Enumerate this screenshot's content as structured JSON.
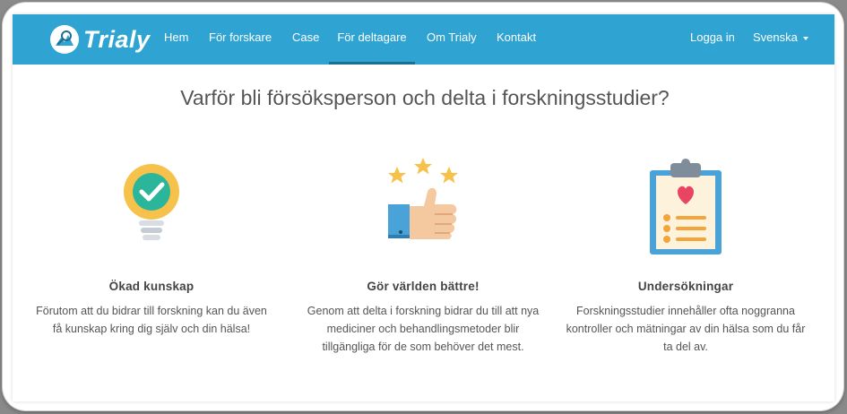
{
  "brand": {
    "name": "Trialy"
  },
  "nav": {
    "items": [
      {
        "label": "Hem"
      },
      {
        "label": "För forskare"
      },
      {
        "label": "Case"
      },
      {
        "label": "För deltagare",
        "active": true
      },
      {
        "label": "Om Trialy"
      },
      {
        "label": "Kontakt"
      }
    ],
    "login": "Logga in",
    "language": "Svenska"
  },
  "main": {
    "headline": "Varför bli försöksperson och delta i forskningsstudier?",
    "features": [
      {
        "icon": "lightbulb-check-icon",
        "title": "Ökad kunskap",
        "text": "Förutom att du bidrar till forskning kan du även få kunskap kring dig själv och din hälsa!"
      },
      {
        "icon": "thumbs-up-stars-icon",
        "title": "Gör världen bättre!",
        "text": "Genom att delta i forskning bidrar du till att nya mediciner och behandlingsmetoder blir tillgängliga för de som behöver det mest."
      },
      {
        "icon": "clipboard-heart-icon",
        "title": "Undersökningar",
        "text": "Forskningsstudier innehåller ofta noggranna kontroller och mätningar av din hälsa som du får ta del av."
      }
    ]
  },
  "colors": {
    "navbar": "#2fa3d1",
    "nav_active_underline": "#1d6f90",
    "heading_text": "#555555"
  }
}
